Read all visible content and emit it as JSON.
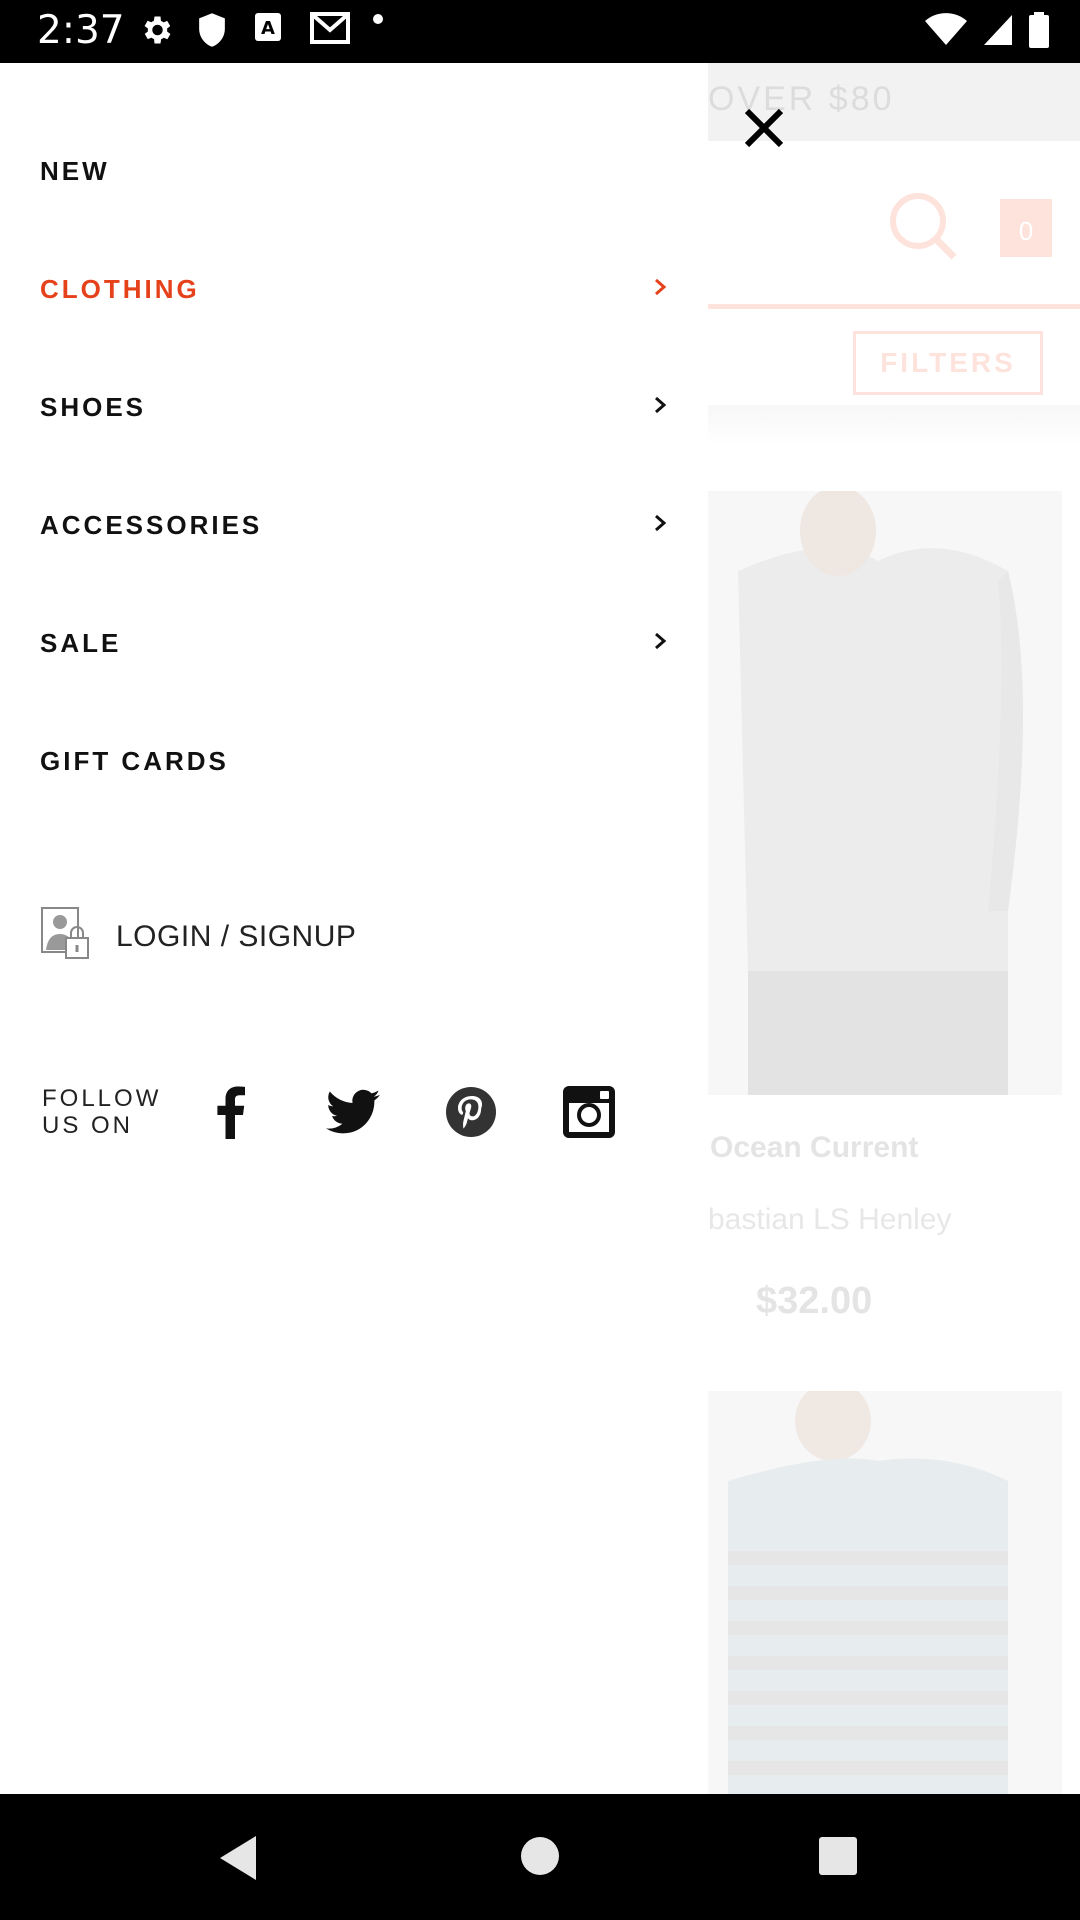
{
  "status_bar": {
    "time": "2:37"
  },
  "background": {
    "promo_text": "OVER $80",
    "cart_count": "0",
    "filters_label": "FILTERS",
    "product": {
      "brand": "Ocean Current",
      "name": "bastian LS Henley",
      "price": "$32.00"
    }
  },
  "menu": {
    "items": [
      {
        "label": "NEW",
        "has_arrow": false,
        "active": false
      },
      {
        "label": "CLOTHING",
        "has_arrow": true,
        "active": true
      },
      {
        "label": "SHOES",
        "has_arrow": true,
        "active": false
      },
      {
        "label": "ACCESSORIES",
        "has_arrow": true,
        "active": false
      },
      {
        "label": "SALE",
        "has_arrow": true,
        "active": false
      },
      {
        "label": "GIFT CARDS",
        "has_arrow": false,
        "active": false
      }
    ],
    "login_label": "LOGIN / SIGNUP",
    "follow_line1": "FOLLOW",
    "follow_line2": "US ON",
    "social": [
      "facebook-icon",
      "twitter-icon",
      "pinterest-icon",
      "instagram-icon"
    ]
  },
  "colors": {
    "accent": "#e5411a",
    "text": "#111111"
  }
}
